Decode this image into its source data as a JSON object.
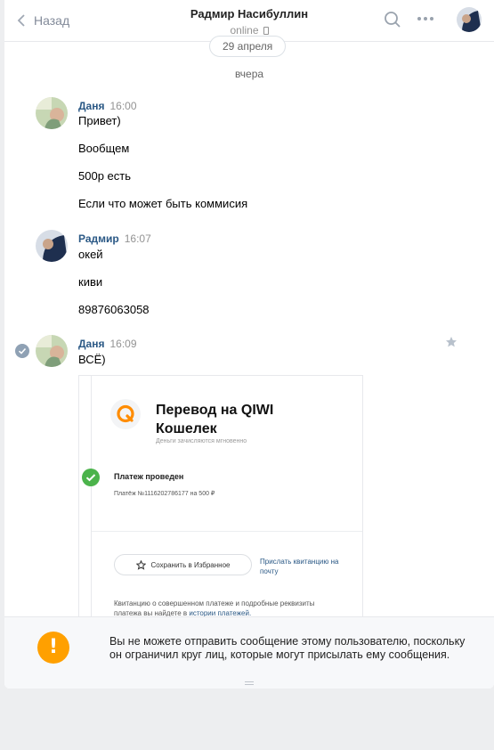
{
  "header": {
    "back_label": "Назад",
    "contact_name": "Радмир Насибуллин",
    "status": "online",
    "icons": [
      "chevron-left-icon",
      "phone-icon",
      "search-icon",
      "more-icon"
    ]
  },
  "date_pill": "29 апреля",
  "day_label": "вчера",
  "messages": [
    {
      "author": "Даня",
      "time": "16:00",
      "lines": [
        "Привет)",
        "Вообщем",
        "500р есть",
        "Если что может быть коммисия"
      ]
    },
    {
      "author": "Радмир",
      "time": "16:07",
      "lines": [
        "окей",
        "киви",
        "89876063058"
      ]
    },
    {
      "author": "Даня",
      "time": "16:09",
      "lines": [
        "ВСЁ)"
      ]
    }
  ],
  "qiwi_card": {
    "title": "Перевод на QIWI Кошелек",
    "subtitle": "Деньги зачисляются мгновенно",
    "status_title": "Платеж проведен",
    "status_detail": "Платёж №1116202786177 на 500 ₽",
    "save_button": "Сохранить в Избранное",
    "receipt_link": "Прислать квитанцию на почту",
    "receipt_text": "Квитанцию о совершенном платеже и подробные реквизиты платежа вы найдете в ",
    "receipt_history_link": "истории платежей."
  },
  "notice": {
    "icon": "!",
    "text": "Вы не можете отправить сообщение этому пользователю, поскольку он ограничил круг лиц, которые могут присылать ему сообщения."
  },
  "colors": {
    "link": "#2a5885",
    "qiwi_orange": "#ff8c00",
    "success_green": "#4bb34b",
    "warning_orange": "#ffa000"
  }
}
